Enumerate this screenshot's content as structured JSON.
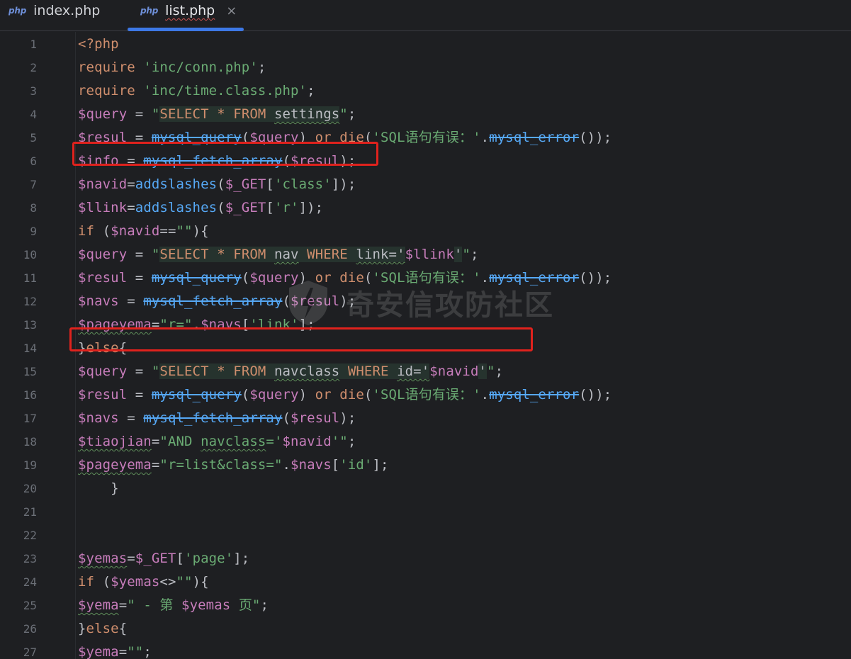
{
  "tabs": [
    {
      "icon": "php",
      "label": "index.php",
      "active": false
    },
    {
      "icon": "php",
      "label": "list.php",
      "active": true,
      "close": "×"
    }
  ],
  "watermark": "奇安信攻防社区",
  "colors": {
    "background": "#1e1f22",
    "keyword": "#cf8e6d",
    "string": "#6aab73",
    "variable": "#c77dbb",
    "function": "#56a8f5",
    "line_number": "#6b6f77",
    "highlight_box": "#e0221d",
    "tab_indicator": "#3d78e6"
  },
  "highlighted_lines": [
    7,
    15
  ],
  "lines": [
    {
      "n": "1",
      "tokens": [
        {
          "t": "<?php",
          "c": "kw"
        }
      ]
    },
    {
      "n": "2",
      "tokens": [
        {
          "t": "require ",
          "c": "kw"
        },
        {
          "t": "'inc/conn.php'",
          "c": "str"
        },
        {
          "t": ";",
          "c": "plain"
        }
      ]
    },
    {
      "n": "3",
      "tokens": [
        {
          "t": "require ",
          "c": "kw"
        },
        {
          "t": "'inc/time.class.php'",
          "c": "str"
        },
        {
          "t": ";",
          "c": "plain"
        }
      ]
    },
    {
      "n": "4",
      "tokens": [
        {
          "t": "$query",
          "c": "var"
        },
        {
          "t": " = ",
          "c": "plain"
        },
        {
          "t": "\"",
          "c": "str"
        },
        {
          "t": "SELECT * FROM settings",
          "c": "sqlline"
        },
        {
          "t": "\"",
          "c": "str"
        },
        {
          "t": ";",
          "c": "plain"
        }
      ]
    },
    {
      "n": "5",
      "tokens": [
        {
          "t": "$resul",
          "c": "var"
        },
        {
          "t": " = ",
          "c": "plain"
        },
        {
          "t": "mysql_query",
          "c": "dep"
        },
        {
          "t": "(",
          "c": "plain"
        },
        {
          "t": "$query",
          "c": "var"
        },
        {
          "t": ") ",
          "c": "plain"
        },
        {
          "t": "or ",
          "c": "kw"
        },
        {
          "t": "die",
          "c": "kw"
        },
        {
          "t": "(",
          "c": "plain"
        },
        {
          "t": "'SQL语句有误：'",
          "c": "str"
        },
        {
          "t": ".",
          "c": "plain"
        },
        {
          "t": "mysql_error",
          "c": "dep"
        },
        {
          "t": "());",
          "c": "plain"
        }
      ]
    },
    {
      "n": "6",
      "tokens": [
        {
          "t": "$info",
          "c": "var"
        },
        {
          "t": " = ",
          "c": "plain"
        },
        {
          "t": "mysql_fetch_array",
          "c": "dep"
        },
        {
          "t": "(",
          "c": "plain"
        },
        {
          "t": "$resul",
          "c": "var"
        },
        {
          "t": ");",
          "c": "plain"
        }
      ]
    },
    {
      "n": "7",
      "tokens": [
        {
          "t": "$navid",
          "c": "var"
        },
        {
          "t": "=",
          "c": "plain"
        },
        {
          "t": "addslashes",
          "c": "fn"
        },
        {
          "t": "(",
          "c": "plain"
        },
        {
          "t": "$_GET",
          "c": "var"
        },
        {
          "t": "[",
          "c": "plain"
        },
        {
          "t": "'class'",
          "c": "str"
        },
        {
          "t": "]);",
          "c": "plain"
        }
      ]
    },
    {
      "n": "8",
      "tokens": [
        {
          "t": "$llink",
          "c": "var"
        },
        {
          "t": "=",
          "c": "plain"
        },
        {
          "t": "addslashes",
          "c": "fn"
        },
        {
          "t": "(",
          "c": "plain"
        },
        {
          "t": "$_GET",
          "c": "var"
        },
        {
          "t": "[",
          "c": "plain"
        },
        {
          "t": "'r'",
          "c": "str"
        },
        {
          "t": "]);",
          "c": "plain"
        }
      ]
    },
    {
      "n": "9",
      "tokens": [
        {
          "t": "if ",
          "c": "kw"
        },
        {
          "t": "(",
          "c": "plain"
        },
        {
          "t": "$navid",
          "c": "var"
        },
        {
          "t": "==",
          "c": "plain"
        },
        {
          "t": "\"\"",
          "c": "str"
        },
        {
          "t": "){",
          "c": "plain"
        }
      ]
    },
    {
      "n": "10",
      "tokens": [
        {
          "t": "$query",
          "c": "var"
        },
        {
          "t": " = ",
          "c": "plain"
        },
        {
          "t": "\"",
          "c": "str"
        },
        {
          "t": "SELECT * FROM nav WHERE link='",
          "c": "sqlline"
        },
        {
          "t": "$llink",
          "c": "var"
        },
        {
          "t": "'",
          "c": "sqlline"
        },
        {
          "t": "\"",
          "c": "str"
        },
        {
          "t": ";",
          "c": "plain"
        }
      ]
    },
    {
      "n": "11",
      "tokens": [
        {
          "t": "$resul",
          "c": "var"
        },
        {
          "t": " = ",
          "c": "plain"
        },
        {
          "t": "mysql_query",
          "c": "dep"
        },
        {
          "t": "(",
          "c": "plain"
        },
        {
          "t": "$query",
          "c": "var"
        },
        {
          "t": ") ",
          "c": "plain"
        },
        {
          "t": "or ",
          "c": "kw"
        },
        {
          "t": "die",
          "c": "kw"
        },
        {
          "t": "(",
          "c": "plain"
        },
        {
          "t": "'SQL语句有误：'",
          "c": "str"
        },
        {
          "t": ".",
          "c": "plain"
        },
        {
          "t": "mysql_error",
          "c": "dep"
        },
        {
          "t": "());",
          "c": "plain"
        }
      ]
    },
    {
      "n": "12",
      "tokens": [
        {
          "t": "$navs",
          "c": "var"
        },
        {
          "t": " = ",
          "c": "plain"
        },
        {
          "t": "mysql_fetch_array",
          "c": "dep"
        },
        {
          "t": "(",
          "c": "plain"
        },
        {
          "t": "$resul",
          "c": "var"
        },
        {
          "t": ");",
          "c": "plain"
        }
      ]
    },
    {
      "n": "13",
      "tokens": [
        {
          "t": "$pageyema",
          "c": "varw"
        },
        {
          "t": "=",
          "c": "plain"
        },
        {
          "t": "\"r=\"",
          "c": "str"
        },
        {
          "t": ".",
          "c": "plain"
        },
        {
          "t": "$navs",
          "c": "var"
        },
        {
          "t": "[",
          "c": "plain"
        },
        {
          "t": "'link'",
          "c": "str"
        },
        {
          "t": "];",
          "c": "plain"
        }
      ]
    },
    {
      "n": "14",
      "tokens": [
        {
          "t": "}",
          "c": "plain"
        },
        {
          "t": "else",
          "c": "kw"
        },
        {
          "t": "{",
          "c": "plain"
        }
      ]
    },
    {
      "n": "15",
      "tokens": [
        {
          "t": "$query",
          "c": "var"
        },
        {
          "t": " = ",
          "c": "plain"
        },
        {
          "t": "\"",
          "c": "str"
        },
        {
          "t": "SELECT * FROM navclass WHERE id='",
          "c": "sqlline"
        },
        {
          "t": "$navid",
          "c": "var"
        },
        {
          "t": "'",
          "c": "sqlline"
        },
        {
          "t": "\"",
          "c": "str"
        },
        {
          "t": ";",
          "c": "plain"
        }
      ]
    },
    {
      "n": "16",
      "tokens": [
        {
          "t": "$resul",
          "c": "var"
        },
        {
          "t": " = ",
          "c": "plain"
        },
        {
          "t": "mysql_query",
          "c": "dep"
        },
        {
          "t": "(",
          "c": "plain"
        },
        {
          "t": "$query",
          "c": "var"
        },
        {
          "t": ") ",
          "c": "plain"
        },
        {
          "t": "or ",
          "c": "kw"
        },
        {
          "t": "die",
          "c": "kw"
        },
        {
          "t": "(",
          "c": "plain"
        },
        {
          "t": "'SQL语句有误：'",
          "c": "str"
        },
        {
          "t": ".",
          "c": "plain"
        },
        {
          "t": "mysql_error",
          "c": "dep"
        },
        {
          "t": "());",
          "c": "plain"
        }
      ]
    },
    {
      "n": "17",
      "tokens": [
        {
          "t": "$navs",
          "c": "var"
        },
        {
          "t": " = ",
          "c": "plain"
        },
        {
          "t": "mysql_fetch_array",
          "c": "dep"
        },
        {
          "t": "(",
          "c": "plain"
        },
        {
          "t": "$resul",
          "c": "var"
        },
        {
          "t": ");",
          "c": "plain"
        }
      ]
    },
    {
      "n": "18",
      "tokens": [
        {
          "t": "$tiaojian",
          "c": "varw"
        },
        {
          "t": "=",
          "c": "plain"
        },
        {
          "t": "\"AND ",
          "c": "str"
        },
        {
          "t": "navclass",
          "c": "strw"
        },
        {
          "t": "='",
          "c": "str"
        },
        {
          "t": "$navid",
          "c": "var"
        },
        {
          "t": "'\"",
          "c": "str"
        },
        {
          "t": ";",
          "c": "plain"
        }
      ]
    },
    {
      "n": "19",
      "tokens": [
        {
          "t": "$pageyema",
          "c": "varw"
        },
        {
          "t": "=",
          "c": "plain"
        },
        {
          "t": "\"r=list&class=\"",
          "c": "str"
        },
        {
          "t": ".",
          "c": "plain"
        },
        {
          "t": "$navs",
          "c": "var"
        },
        {
          "t": "[",
          "c": "plain"
        },
        {
          "t": "'id'",
          "c": "str"
        },
        {
          "t": "];",
          "c": "plain"
        }
      ]
    },
    {
      "n": "20",
      "tokens": [
        {
          "t": "    }",
          "c": "plain"
        }
      ]
    },
    {
      "n": "21",
      "tokens": []
    },
    {
      "n": "22",
      "tokens": []
    },
    {
      "n": "23",
      "tokens": [
        {
          "t": "$yemas",
          "c": "varw"
        },
        {
          "t": "=",
          "c": "plain"
        },
        {
          "t": "$_GET",
          "c": "var"
        },
        {
          "t": "[",
          "c": "plain"
        },
        {
          "t": "'page'",
          "c": "str"
        },
        {
          "t": "];",
          "c": "plain"
        }
      ]
    },
    {
      "n": "24",
      "tokens": [
        {
          "t": "if ",
          "c": "kw"
        },
        {
          "t": "(",
          "c": "plain"
        },
        {
          "t": "$yemas",
          "c": "var"
        },
        {
          "t": "<>",
          "c": "plain"
        },
        {
          "t": "\"\"",
          "c": "str"
        },
        {
          "t": "){",
          "c": "plain"
        }
      ]
    },
    {
      "n": "25",
      "tokens": [
        {
          "t": "$yema",
          "c": "varw"
        },
        {
          "t": "=",
          "c": "plain"
        },
        {
          "t": "\" - 第 ",
          "c": "str"
        },
        {
          "t": "$yemas",
          "c": "var"
        },
        {
          "t": " 页\"",
          "c": "str"
        },
        {
          "t": ";",
          "c": "plain"
        }
      ]
    },
    {
      "n": "26",
      "tokens": [
        {
          "t": "}",
          "c": "plain"
        },
        {
          "t": "else",
          "c": "kw"
        },
        {
          "t": "{",
          "c": "plain"
        }
      ]
    },
    {
      "n": "27",
      "tokens": [
        {
          "t": "$yema",
          "c": "varw"
        },
        {
          "t": "=",
          "c": "plain"
        },
        {
          "t": "\"\"",
          "c": "str"
        },
        {
          "t": ";",
          "c": "plain"
        }
      ]
    }
  ]
}
